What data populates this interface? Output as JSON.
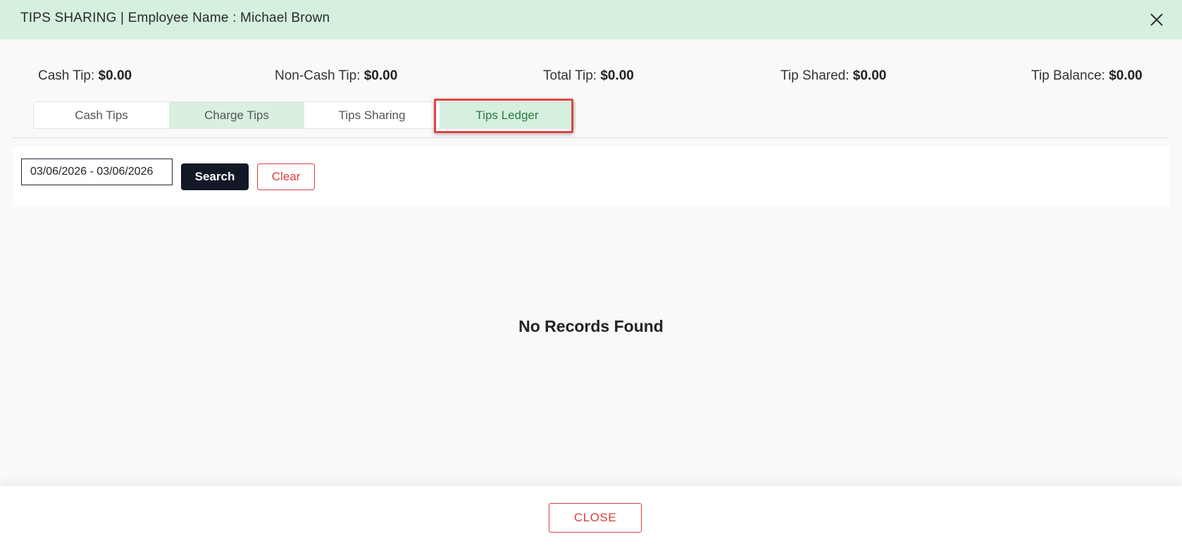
{
  "header": {
    "title": "TIPS SHARING | Employee Name : Michael Brown",
    "close_icon": "close-icon"
  },
  "summary": {
    "cash_tip_label": "Cash Tip:",
    "cash_tip_value": "$0.00",
    "non_cash_tip_label": "Non-Cash Tip:",
    "non_cash_tip_value": "$0.00",
    "total_tip_label": "Total Tip:",
    "total_tip_value": "$0.00",
    "tip_shared_label": "Tip Shared:",
    "tip_shared_value": "$0.00",
    "tip_balance_label": "Tip Balance:",
    "tip_balance_value": "$0.00"
  },
  "tabs": [
    {
      "label": "Cash Tips"
    },
    {
      "label": "Charge Tips"
    },
    {
      "label": "Tips Sharing"
    },
    {
      "label": "Tips Ledger"
    }
  ],
  "selected_tab": "Tips Ledger",
  "filter": {
    "date_range_value": "03/06/2026 - 03/06/2026",
    "search_label": "Search",
    "clear_label": "Clear"
  },
  "empty_state": "No Records Found",
  "footer": {
    "close_label": "CLOSE"
  },
  "colors": {
    "header_bg": "#d5f0df",
    "primary_dark": "#121826",
    "danger": "#d94040",
    "tab_selected_text": "#2d7a45",
    "highlight": "#e04444"
  }
}
